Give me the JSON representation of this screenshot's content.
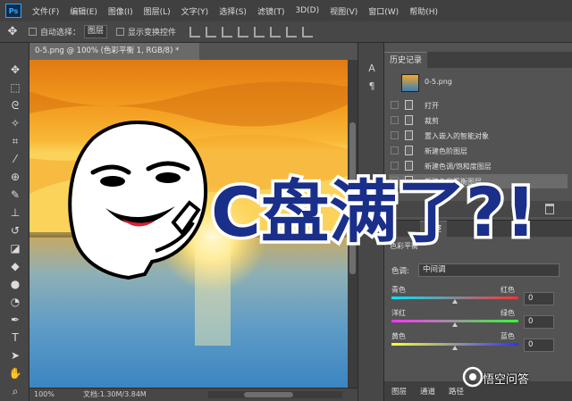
{
  "menu": {
    "logo": "Ps",
    "items": [
      "文件(F)",
      "编辑(E)",
      "图像(I)",
      "图层(L)",
      "文字(Y)",
      "选择(S)",
      "滤镜(T)",
      "3D(D)",
      "视图(V)",
      "窗口(W)",
      "帮助(H)"
    ]
  },
  "options": {
    "auto_select_label": "自动选择：",
    "auto_select_value": "图层",
    "transform_label": "显示变换控件"
  },
  "document": {
    "tab_title": "0-5.png @ 100% (色彩平衡 1, RGB/8) *",
    "zoom": "100%",
    "doc_info": "文档:1.30M/3.84M"
  },
  "history": {
    "tab_label": "历史记录",
    "snapshot_label": "0-5.png",
    "items": [
      "打开",
      "裁剪",
      "置入嵌入的智能对象",
      "新建色阶图层",
      "新建色调/饱和度图层",
      "新建色彩平衡图层"
    ]
  },
  "adjustments": {
    "tab_label": "调整",
    "subtitle": "色彩平衡",
    "tone_label": "色调:",
    "tone_value": "中间调",
    "sliders": [
      {
        "left": "青色",
        "right": "红色",
        "value": "0"
      },
      {
        "left": "洋红",
        "right": "绿色",
        "value": "0"
      },
      {
        "left": "黄色",
        "right": "蓝色",
        "value": "0"
      }
    ],
    "footer_tabs": [
      "图层",
      "通道",
      "路径"
    ]
  },
  "overlay": {
    "caption": "C盘满了?!",
    "watermark": "悟空问答"
  },
  "colors": {
    "accent": "#31a8ff",
    "caption_fill": "#1a2f8a",
    "caption_stroke": "#ffffff"
  }
}
